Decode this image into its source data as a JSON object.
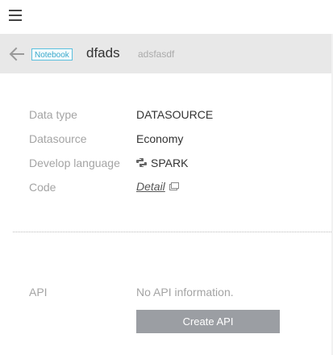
{
  "header": {
    "badge": "Notebook",
    "title": "dfads",
    "subtitle": "adsfasdf"
  },
  "details": {
    "data_type_label": "Data type",
    "data_type_value": "DATASOURCE",
    "datasource_label": "Datasource",
    "datasource_value": "Economy",
    "language_label": "Develop language",
    "language_value": "SPARK",
    "code_label": "Code",
    "code_link": "Detail"
  },
  "api": {
    "label": "API",
    "empty_text": "No API information.",
    "create_button": "Create API"
  },
  "icons": {
    "menu": "hamburger-menu-icon",
    "back": "arrow-left-icon",
    "language": "python-icon",
    "detail": "external-window-icon"
  },
  "colors": {
    "badge_border": "#5bc0de",
    "header_bg": "#e8e8e8",
    "button_bg": "#9b9ea3"
  }
}
